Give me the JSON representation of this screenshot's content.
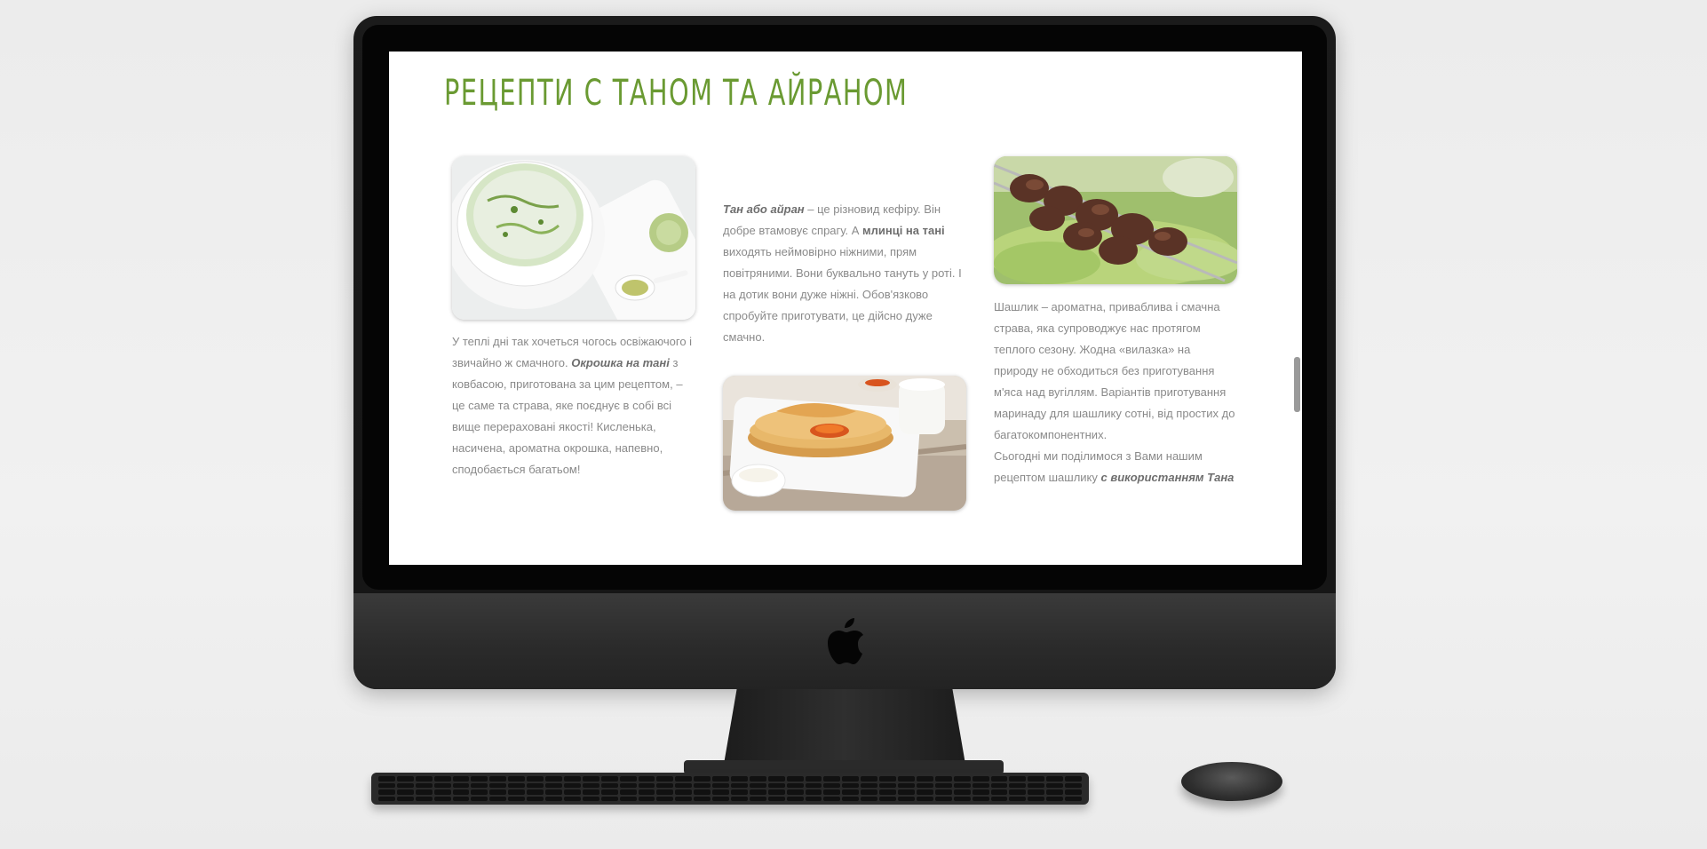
{
  "page": {
    "title": "РЕЦЕПТИ С ТАНОМ ТА АЙРАНОМ",
    "accent_color": "#6a9a32",
    "text_color": "#8a8a8a"
  },
  "cards": [
    {
      "image": "okroshka-photo",
      "text_1": "У теплі дні так хочеться чогось освіжаючого і звичайно ж смачного. ",
      "bold_italic_1": "Окрошка на тані",
      "text_2": " з ковбасою, приготована за цим рецептом, – це саме та страва, яке поєднує в собі всі вище перераховані якості! Кисленька, насичена, ароматна окрошка, напевно, сподобається багатьом!"
    },
    {
      "image": "pancakes-photo",
      "bold_italic_1": "Тан або айран",
      "text_1": " – це різновид кефіру. Він добре втамовує спрагу. А ",
      "bold_1": "млинці на тані",
      "text_2": " виходять неймовірно ніжними, прям повітряними. Вони буквально тануть у роті. І на дотик вони дуже ніжні. Обов'язково спробуйте приготувати, це дійсно дуже смачно."
    },
    {
      "image": "shashlik-photo",
      "text_1": "Шашлик – ароматна, приваблива і смачна страва, яка супроводжує нас протягом теплого сезону. Жодна «вилазка» на природу не обходиться без приготування м'яса над вугіллям. Варіантів приготування маринаду для шашлику сотні, від простих до багатокомпонентних.",
      "text_2": "Сьогодні ми поділимося з Вами нашим рецептом шашлику ",
      "bold_italic_1": "с використанням Тана"
    }
  ],
  "device": {
    "logo_icon": "apple-logo-icon"
  }
}
